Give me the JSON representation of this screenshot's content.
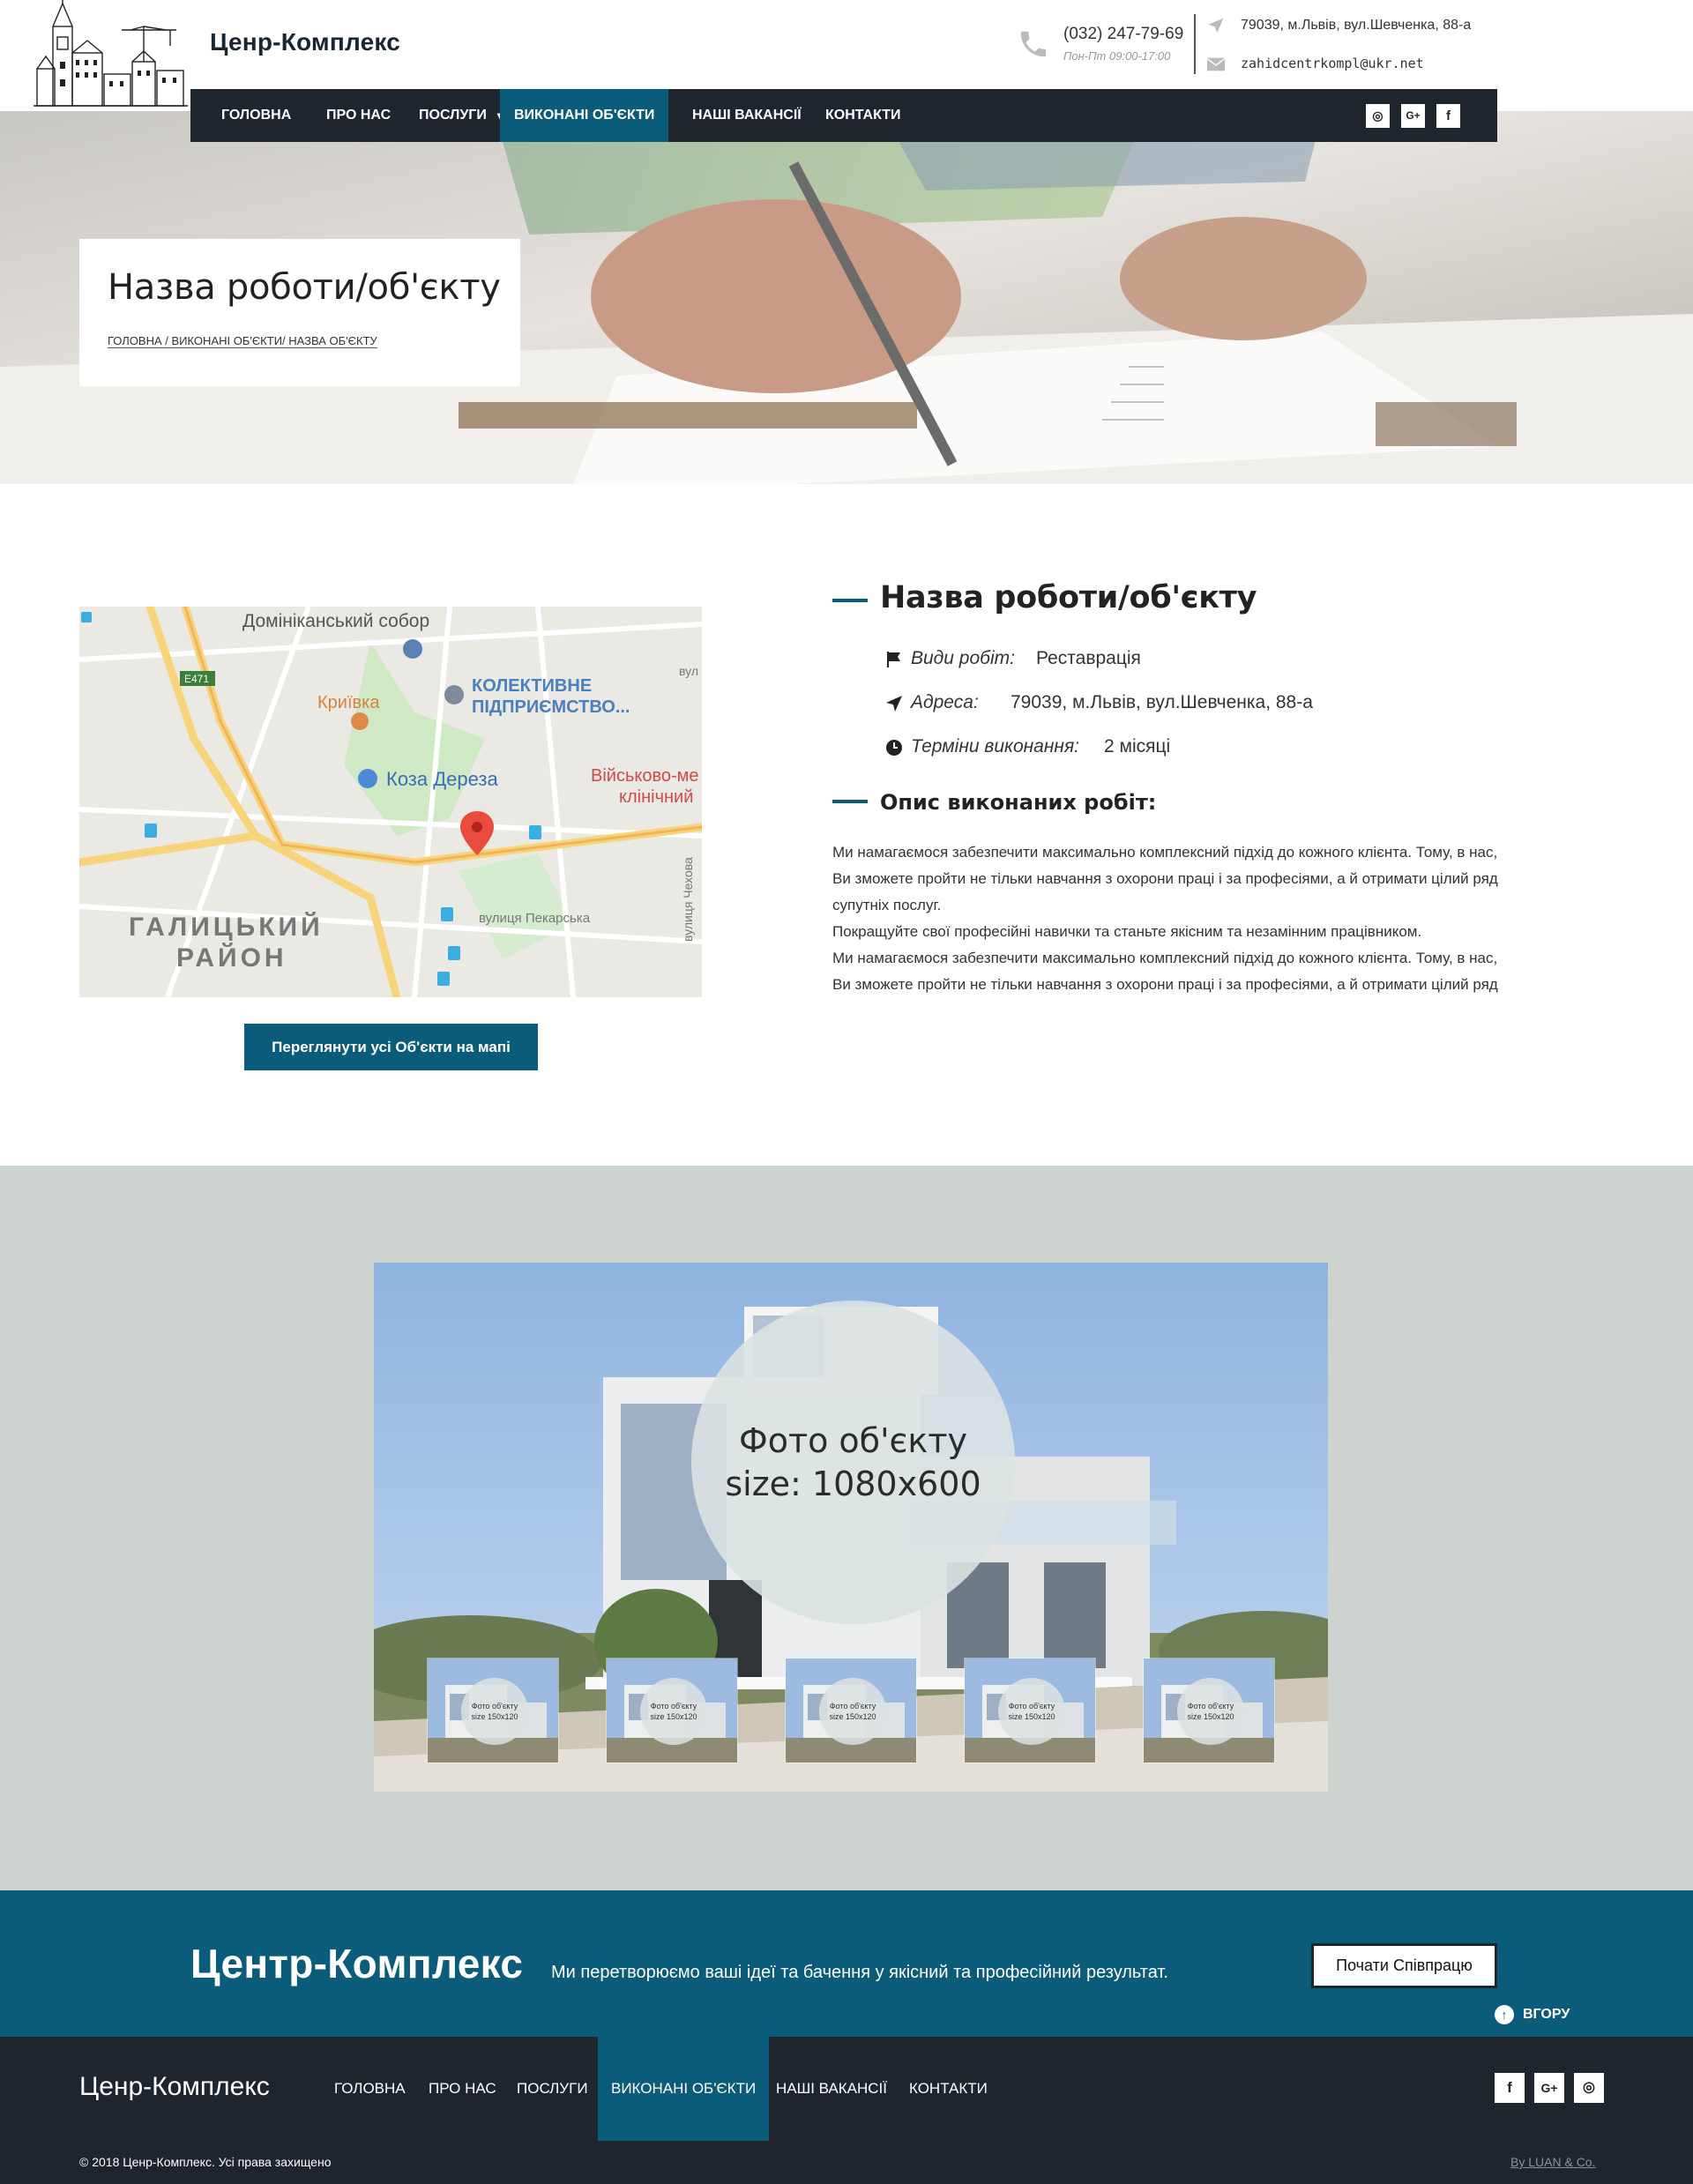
{
  "header": {
    "brand": "Ценр-Комплекс",
    "phone": "(032) 247-79-69",
    "hours": "Пон-Пт 09:00-17:00",
    "address": "79039, м.Львів, вул.Шевченка, 88-а",
    "email": "zahidcentrkompl@ukr.net"
  },
  "nav": {
    "items": [
      "ГОЛОВНА",
      "ПРО НАС",
      "ПОСЛУГИ",
      "ВИКОНАНІ ОБ'ЄКТИ",
      "НАШІ ВАКАНСІЇ",
      "КОНТАКТИ"
    ],
    "active": "ВИКОНАНІ ОБ'ЄКТИ",
    "dropdown_icon": "chevron-down-icon",
    "social": [
      "instagram-icon",
      "google-plus-icon",
      "facebook-icon"
    ],
    "social_labels": [
      "◎",
      "G+",
      "f"
    ]
  },
  "hero": {
    "title": "Назва роботи/об'єкту",
    "breadcrumb": [
      "ГОЛОВНА / ",
      "ВИКОНАНІ ОБ'ЄКТИ",
      "/ НАЗВА ОБ'ЄКТУ"
    ]
  },
  "map": {
    "labels": [
      "Домініканський собор",
      "E471",
      "Криївка",
      "КОЛЕКТИВНЕ",
      "ПІДПРИЄМСТВО...",
      "Коза Дереза",
      "Військово-ме",
      "клінічний",
      "ГАЛИЦЬКИЙ",
      "РАЙОН",
      "вулиця Пекарська",
      "вулиця Чехова",
      "вул"
    ],
    "button": "Переглянути усі Об'єкти на мапі"
  },
  "object": {
    "title": "Назва роботи/об'єкту",
    "work_type_label": "Види робіт:",
    "work_type": "Реставрація",
    "address_label": "Адреса:",
    "address": "79039, м.Львів, вул.Шевченка, 88-а",
    "term_label": "Терміни виконання:",
    "term": "2 місяці",
    "desc_title": "Опис виконаних робіт:",
    "desc_lines": [
      "Ми намагаємося забезпечити максимально комплексний підхід до кожного клієнта. Тому, в нас,",
      "Ви зможете пройти не тільки навчання з охорони праці і за професіями, а й отримати цілий ряд",
      "супутніх послуг.",
      "Покращуйте свої професійні навички та станьте якісним та незамінним працівником.",
      "Ми намагаємося забезпечити максимально комплексний підхід до кожного клієнта. Тому, в нас,",
      "Ви зможете пройти не тільки навчання з охорони праці і за професіями, а й отримати цілий ряд"
    ]
  },
  "gallery": {
    "main_line1": "Фото об'єкту",
    "main_line2": "size: 1080x600",
    "thumb_line1": "Фото об'єкту",
    "thumb_line2": "size 150x120",
    "thumb_count": 5
  },
  "cta": {
    "brand": "Центр-Комплекс",
    "text": "Ми перетворюємо ваші ідеї та бачення у якісний та професійний результат.",
    "button": "Почати Співпрацю",
    "to_top": "ВГОРУ"
  },
  "footer": {
    "brand": "Ценр-Комплекс",
    "nav": [
      "ГОЛОВНА",
      "ПРО НАС",
      "ПОСЛУГИ",
      "ВИКОНАНІ ОБ'ЄКТИ",
      "НАШІ ВАКАНСІЇ",
      "КОНТАКТИ"
    ],
    "active": "ВИКОНАНІ ОБ'ЄКТИ",
    "social": [
      "facebook-icon",
      "google-plus-icon",
      "instagram-icon"
    ],
    "social_labels": [
      "f",
      "G+",
      "◎"
    ],
    "copyright": "© 2018 Ценр-Комплекс. Усі права захищено",
    "credit": "By LUAN & Co."
  },
  "colors": {
    "accent": "#0b5c7a",
    "dark": "#1f252d",
    "gallery_bg": "#cdd4cf"
  }
}
